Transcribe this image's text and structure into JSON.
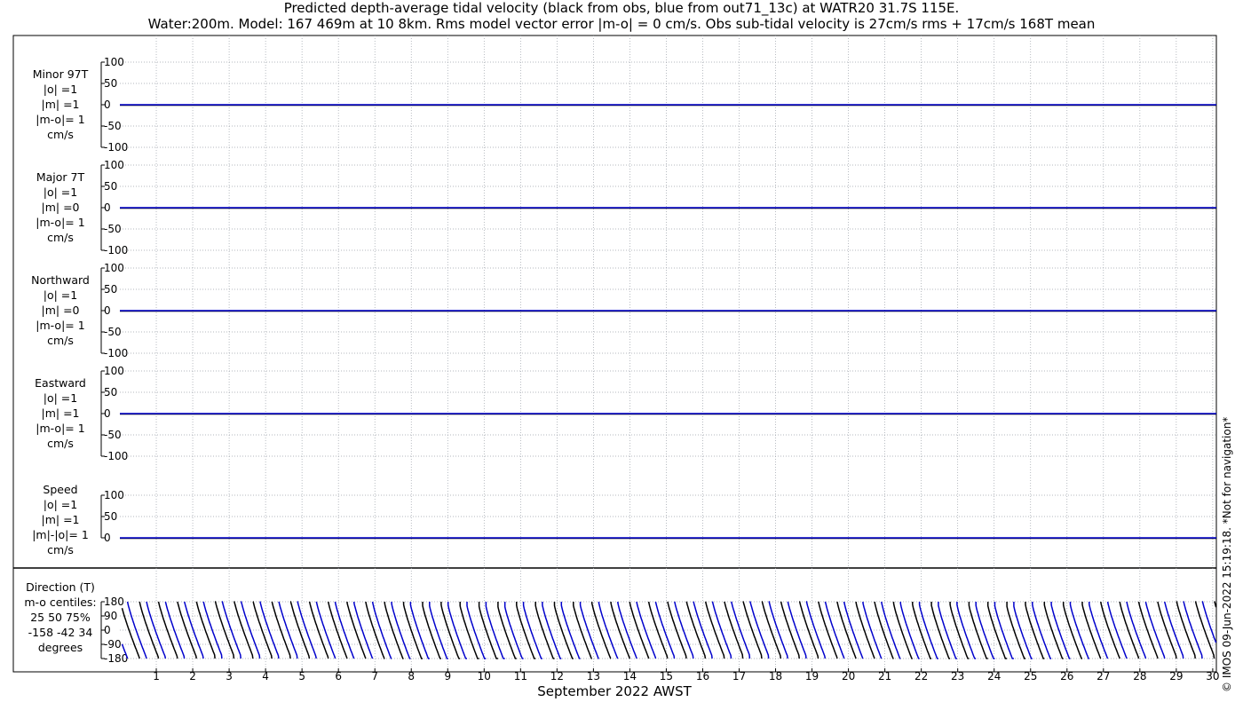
{
  "title_line1": "Predicted depth-average tidal velocity (black from obs, blue from out71_13c) at WATR20 31.7S 115E.",
  "title_line2": "Water:200m. Model: 167 469m at 10 8km. Rms model vector error |m-o| = 0 cm/s. Obs sub-tidal velocity is 27cm/s rms + 17cm/s 168T mean",
  "copyright": "© IMOS 09-Jun-2022 15:19:18. *Not for navigation*",
  "chart_data": {
    "type": "line",
    "xlabel": "September 2022 AWST",
    "x_ticks": [
      "1",
      "2",
      "3",
      "4",
      "5",
      "6",
      "7",
      "8",
      "9",
      "10",
      "11",
      "12",
      "13",
      "14",
      "15",
      "16",
      "17",
      "18",
      "19",
      "20",
      "21",
      "22",
      "23",
      "24",
      "25",
      "26",
      "27",
      "28",
      "29",
      "30"
    ],
    "x_range_days": [
      0,
      30.1
    ],
    "legend": "none",
    "grid": true,
    "colors": {
      "obs": "#000000",
      "model": "#0000cc",
      "grid": "#9aa0a8",
      "axis": "#000000"
    },
    "panels": [
      {
        "label_lines": [
          "Minor 97T",
          "|o| =1",
          "|m| =1",
          "|m-o|= 1",
          "cm/s"
        ],
        "ylim": [
          -100,
          100
        ],
        "yticks": [
          "100",
          "50",
          "0",
          "-50",
          "-100"
        ],
        "obs_value": 0,
        "model_value": 0
      },
      {
        "label_lines": [
          "Major 7T",
          "|o| =1",
          "|m| =0",
          "|m-o|= 1",
          "cm/s"
        ],
        "ylim": [
          -100,
          100
        ],
        "yticks": [
          "100",
          "50",
          "0",
          "-50",
          "-100"
        ],
        "obs_value": 0,
        "model_value": 0
      },
      {
        "label_lines": [
          "Northward",
          "|o| =1",
          "|m| =0",
          "|m-o|= 1",
          "cm/s"
        ],
        "ylim": [
          -100,
          100
        ],
        "yticks": [
          "100",
          "50",
          "0",
          "-50",
          "-100"
        ],
        "obs_value": 0,
        "model_value": 0
      },
      {
        "label_lines": [
          "Eastward",
          "|o| =1",
          "|m| =1",
          "|m-o|= 1",
          "cm/s"
        ],
        "ylim": [
          -100,
          100
        ],
        "yticks": [
          "100",
          "50",
          "0",
          "-50",
          "-100"
        ],
        "obs_value": 0,
        "model_value": 0
      },
      {
        "label_lines": [
          "Speed",
          "|o| =1",
          "|m| =1",
          "|m|-|o|= 1",
          "cm/s"
        ],
        "ylim": [
          0,
          100
        ],
        "yticks": [
          "100",
          "50",
          "0"
        ],
        "obs_value": 0,
        "model_value": 0
      }
    ],
    "direction_panel": {
      "label_lines": [
        "Direction (T)",
        "m-o centiles:",
        "25  50  75%",
        "-158  -42   34",
        "degrees"
      ],
      "ylim": [
        -180,
        180
      ],
      "yticks": [
        "180",
        "90",
        "0",
        "-90",
        "-180"
      ],
      "period_days": 0.5175,
      "obs_phase_days": 0.02,
      "model_phase_days": 0.21
    }
  }
}
